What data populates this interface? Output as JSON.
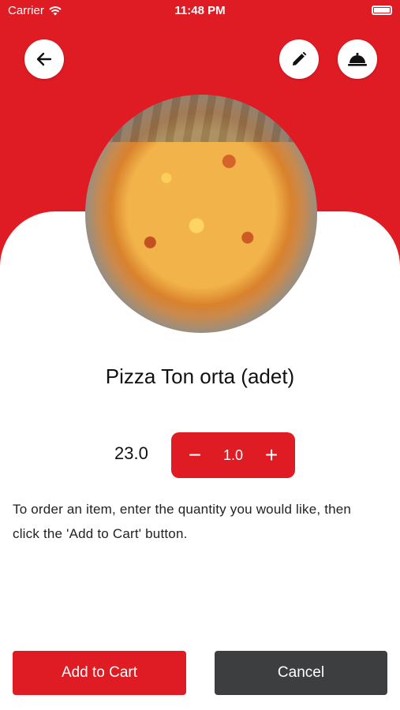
{
  "status_bar": {
    "carrier": "Carrier",
    "time": "11:48 PM"
  },
  "header": {
    "back_icon": "arrow-left-icon",
    "edit_icon": "pencil-icon",
    "service_icon": "cloche-icon"
  },
  "product": {
    "image": "pizza-photo",
    "title": "Pizza Ton orta (adet)",
    "price": "23.0"
  },
  "quantity": {
    "decrement": "−",
    "value": "1.0",
    "increment": "+"
  },
  "instructions": "To order an item, enter the quantity you would like, then click the 'Add to Cart' button.",
  "actions": {
    "add_to_cart": "Add to Cart",
    "cancel": "Cancel"
  },
  "colors": {
    "accent": "#df1b24",
    "cancel_bg": "#3d3e40",
    "background": "#ffffff"
  }
}
